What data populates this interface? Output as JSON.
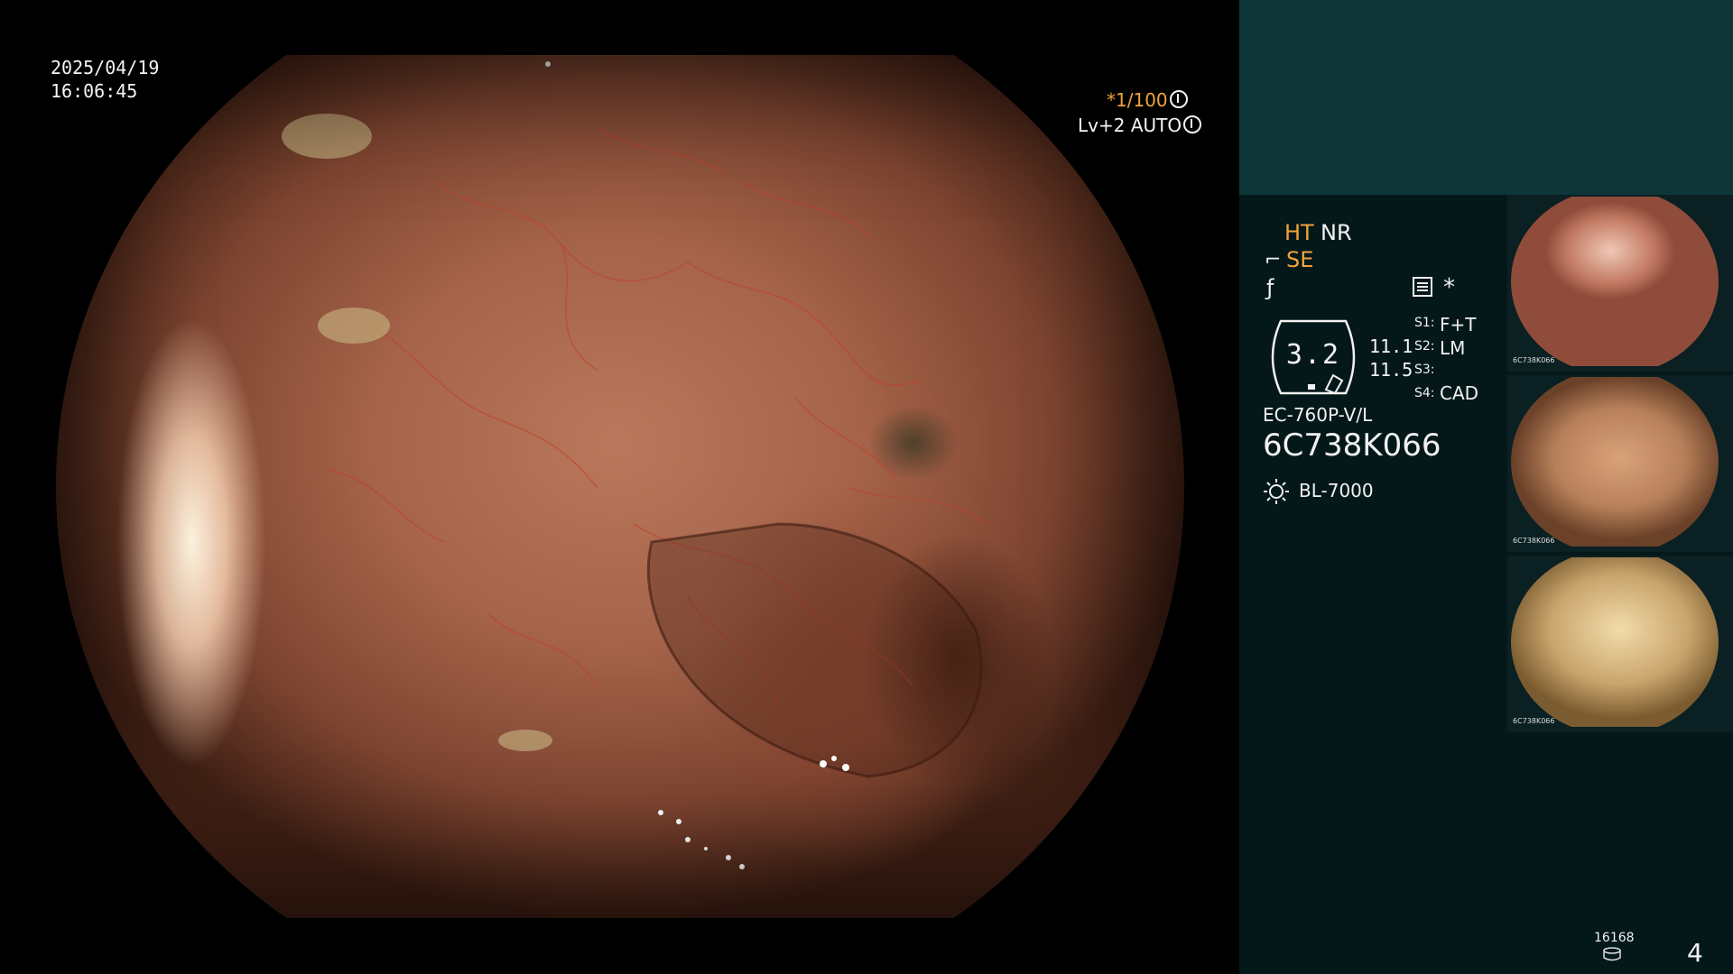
{
  "overlay": {
    "date": "2025/04/19",
    "time": "16:06:45",
    "shutter_prefix": "*",
    "shutter": "1/100",
    "level": "Lv+2",
    "mode": "AUTO"
  },
  "panel": {
    "ht": "HT",
    "nr": "NR",
    "se": "SE",
    "dial_value": "3.2",
    "value_1": "11.1",
    "value_2": "11.5",
    "s1_label": "S1:",
    "s1_value": "F+T",
    "s2_label": "S2:",
    "s2_value": "LM",
    "s3_label": "S3:",
    "s4_label": "S4:",
    "s4_value": "CAD",
    "scope_model": "EC-760P-V/L",
    "scope_serial": "6C738K066",
    "light_source": "BL-7000",
    "counter": "16168",
    "page_number": "4"
  },
  "thumbnails": [
    {
      "caption": "6C738K066"
    },
    {
      "caption": "6C738K066"
    },
    {
      "caption": "6C738K066"
    }
  ],
  "icons": {
    "shutter_icon": "aperture-icon",
    "mode_icon": "auto-iris-icon",
    "se_icon": "scope-icon",
    "f_icon": "signal-icon",
    "menu_icon": "menu-icon",
    "star_icon": "asterisk-icon",
    "bulb_icon": "light-icon",
    "storage_icon": "storage-icon"
  },
  "colors": {
    "accent_orange": "#f0a33a",
    "panel_background": "#04181a",
    "panel_top": "#0e3638"
  }
}
